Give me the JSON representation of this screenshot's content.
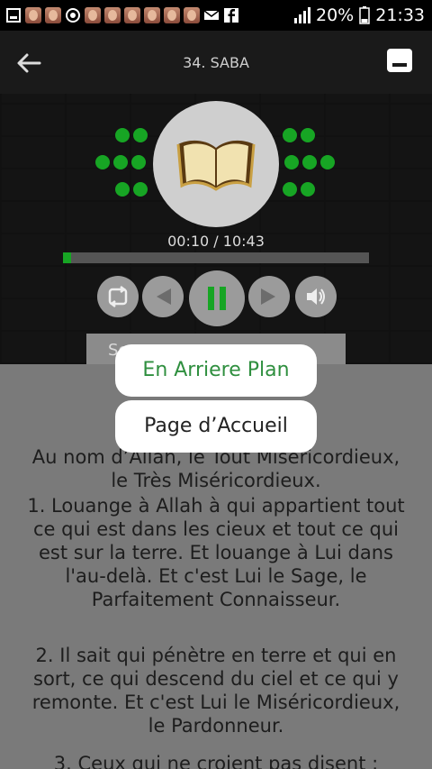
{
  "statusbar": {
    "battery": "20%",
    "time": "21:33"
  },
  "appbar": {
    "title": "34. SABA"
  },
  "player": {
    "elapsed_total": "00:10 / 10:43",
    "progress_fraction": 0.027,
    "search_label": "Se"
  },
  "popups": {
    "background_label": "En Arriere Plan",
    "home_label": "Page d’Accueil"
  },
  "content": {
    "intro": "Au nom d’Allah, le Tout Miséricordieux, le Très Miséricordieux.",
    "verse1": "1. Louange à Allah à qui appartient tout ce qui est dans les cieux et tout ce qui est sur la terre. Et louange à Lui dans l'au-delà. Et c'est Lui le Sage, le Parfaitement Connaisseur.",
    "verse2": "2. Il sait qui pénètre en terre et qui en sort, ce qui descend du ciel et ce qui y remonte. Et c'est Lui le Miséricordieux, le Pardonneur.",
    "verse3": "3. Ceux qui ne croient pas disent :"
  },
  "colors": {
    "accent": "#17a524",
    "popup_text_green": "#2f8f3f"
  }
}
